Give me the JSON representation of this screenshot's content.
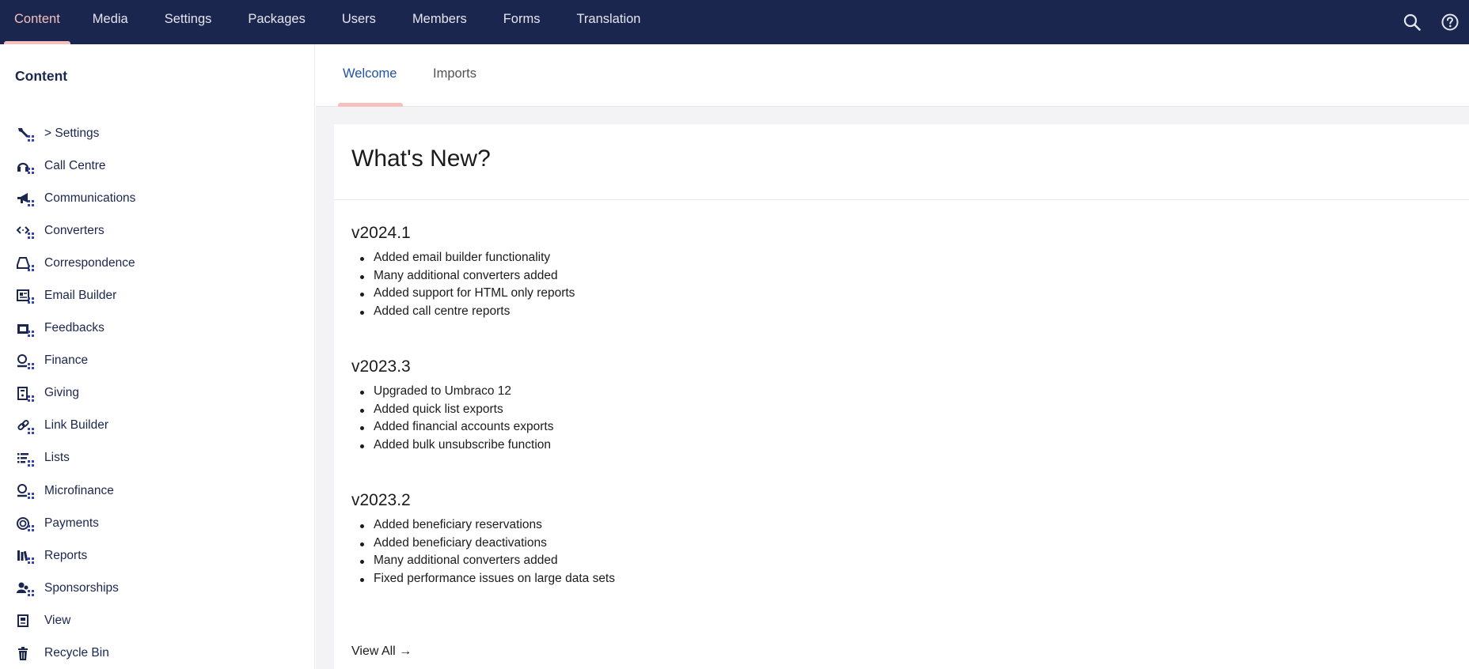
{
  "topnav": {
    "items": [
      "Content",
      "Media",
      "Settings",
      "Packages",
      "Users",
      "Members",
      "Forms",
      "Translation"
    ],
    "active": "Content",
    "icons": [
      "search-icon",
      "help-icon"
    ]
  },
  "sidebar": {
    "title": "Content",
    "items": [
      {
        "label": "> Settings",
        "icon": "wrench-icon"
      },
      {
        "label": "Call Centre",
        "icon": "headset-icon"
      },
      {
        "label": "Communications",
        "icon": "megaphone-icon"
      },
      {
        "label": "Converters",
        "icon": "converter-arrows-icon"
      },
      {
        "label": "Correspondence",
        "icon": "inbox-icon"
      },
      {
        "label": "Email Builder",
        "icon": "newsletter-icon"
      },
      {
        "label": "Feedbacks",
        "icon": "message-icon"
      },
      {
        "label": "Finance",
        "icon": "coin-hand-icon"
      },
      {
        "label": "Giving",
        "icon": "donation-box-icon"
      },
      {
        "label": "Link Builder",
        "icon": "link-icon"
      },
      {
        "label": "Lists",
        "icon": "list-icon"
      },
      {
        "label": "Microfinance",
        "icon": "coin-hand-icon"
      },
      {
        "label": "Payments",
        "icon": "dollar-coin-icon"
      },
      {
        "label": "Reports",
        "icon": "books-icon"
      },
      {
        "label": "Sponsorships",
        "icon": "users-icon"
      },
      {
        "label": "View",
        "icon": "document-icon"
      },
      {
        "label": "Recycle Bin",
        "icon": "trash-icon"
      }
    ]
  },
  "tabs": [
    {
      "label": "Welcome",
      "active": true
    },
    {
      "label": "Imports",
      "active": false
    }
  ],
  "panel": {
    "title": "What's New?",
    "releases": [
      {
        "version": "v2024.1",
        "items": [
          "Added email builder functionality",
          "Many additional converters added",
          "Added support for HTML only reports",
          "Added call centre reports"
        ]
      },
      {
        "version": "v2023.3",
        "items": [
          "Upgraded to Umbraco 12",
          "Added quick list exports",
          "Added financial accounts exports",
          "Added bulk unsubscribe function"
        ]
      },
      {
        "version": "v2023.2",
        "items": [
          "Added beneficiary reservations",
          "Added beneficiary deactivations",
          "Many additional converters added",
          "Fixed performance issues on large data sets"
        ]
      }
    ],
    "view_all": "View All →"
  },
  "colors": {
    "header_bg": "#1b264f",
    "accent_pink": "#f5c1bc",
    "active_tab": "#2152a3",
    "badge_blue": "#3544b1"
  }
}
